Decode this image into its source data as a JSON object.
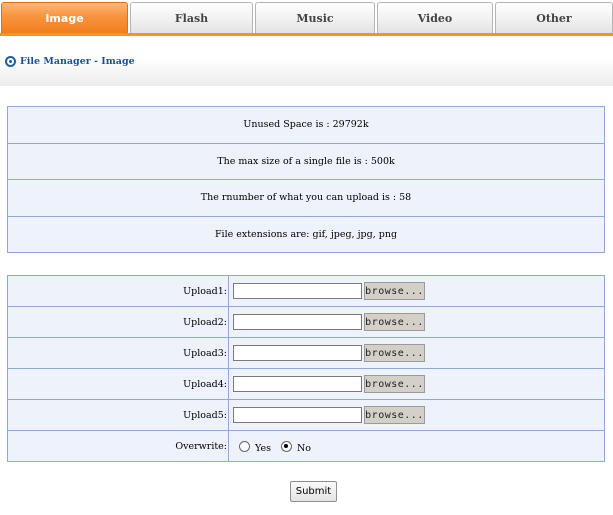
{
  "tabs": [
    {
      "label": "Image",
      "active": true
    },
    {
      "label": "Flash",
      "active": false
    },
    {
      "label": "Music",
      "active": false
    },
    {
      "label": "Video",
      "active": false
    },
    {
      "label": "Other",
      "active": false
    }
  ],
  "breadcrumb": "File Manager - Image",
  "info": [
    "Unused Space is : 29792k",
    "The max size of a single file is : 500k",
    "The rnumber of what you can upload is : 58",
    "File extensions are: gif, jpeg, jpg, png"
  ],
  "uploads": [
    {
      "label": "Upload1:",
      "value": "",
      "browse": "browse..."
    },
    {
      "label": "Upload2:",
      "value": "",
      "browse": "browse..."
    },
    {
      "label": "Upload3:",
      "value": "",
      "browse": "browse..."
    },
    {
      "label": "Upload4:",
      "value": "",
      "browse": "browse..."
    },
    {
      "label": "Upload5:",
      "value": "",
      "browse": "browse..."
    }
  ],
  "overwrite": {
    "label": "Overwrite:",
    "options": [
      {
        "label": "Yes",
        "checked": false
      },
      {
        "label": "No",
        "checked": true
      }
    ]
  },
  "submit_label": "Submit",
  "colors": {
    "active_tab": "#f7941d",
    "link_blue": "#1a4f9c",
    "table_border": "#8eaad4",
    "table_bg": "#eef2fb"
  }
}
